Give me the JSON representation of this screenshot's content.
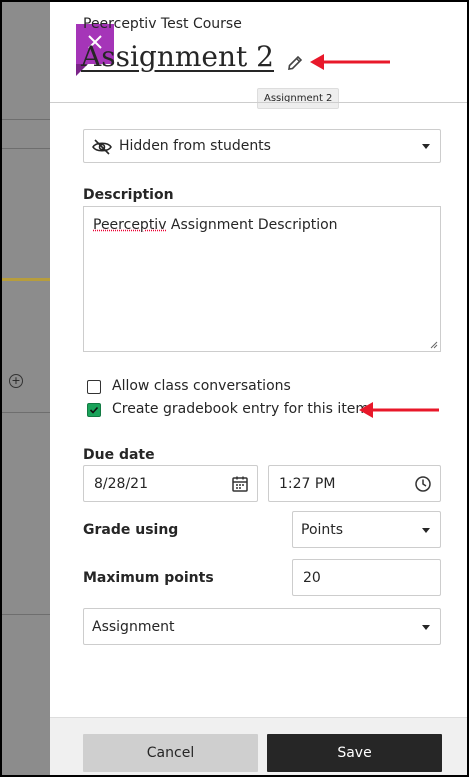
{
  "course_name": "Peerceptiv Test Course",
  "assignment_title": "Assignment 2",
  "tooltip": "Assignment 2",
  "visibility": {
    "selected": "Hidden from students"
  },
  "description": {
    "label": "Description",
    "value_prefix": "Peerceptiv",
    "value_suffix": " Assignment Description"
  },
  "options": {
    "allow_conversations": {
      "label": "Allow class conversations",
      "checked": false
    },
    "gradebook_entry": {
      "label": "Create gradebook entry for this item",
      "checked": true
    }
  },
  "due": {
    "label": "Due date",
    "date": "8/28/21",
    "time": "1:27 PM"
  },
  "grade_using": {
    "label": "Grade using",
    "selected": "Points"
  },
  "max_points": {
    "label": "Maximum points",
    "value": "20"
  },
  "category": {
    "selected": "Assignment"
  },
  "footer": {
    "cancel_label": "Cancel",
    "save_label": "Save"
  },
  "icons": {
    "close": "close-icon",
    "edit": "pencil-icon",
    "visibility": "eye-slash-icon",
    "date": "calendar-icon",
    "time": "clock-icon",
    "annotation": "red-arrow"
  },
  "colors": {
    "accent": "#a535b8",
    "check": "#1aa35a",
    "save_bg": "#262626",
    "arrow": "#e8182a"
  }
}
